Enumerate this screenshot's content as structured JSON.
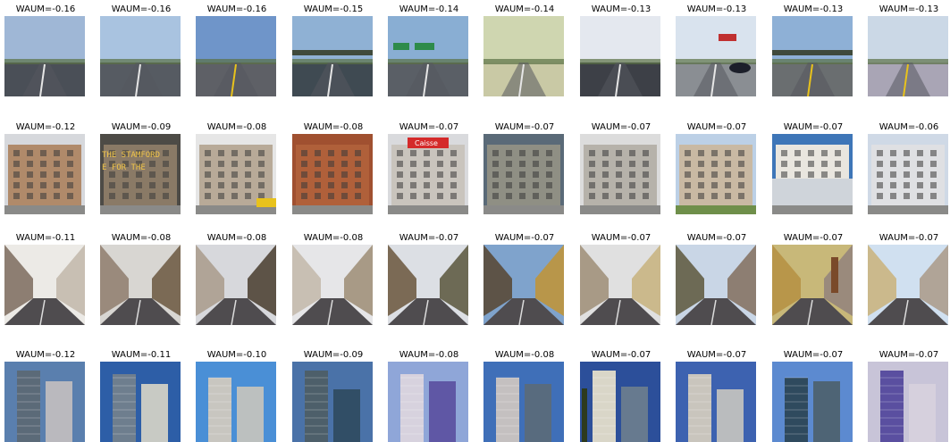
{
  "rows": [
    {
      "scene": "highway",
      "labels": [
        "WAUM=-0.16",
        "WAUM=-0.16",
        "WAUM=-0.16",
        "WAUM=-0.15",
        "WAUM=-0.14",
        "WAUM=-0.14",
        "WAUM=-0.13",
        "WAUM=-0.13",
        "WAUM=-0.13",
        "WAUM=-0.13"
      ]
    },
    {
      "scene": "building",
      "labels": [
        "WAUM=-0.12",
        "WAUM=-0.09",
        "WAUM=-0.08",
        "WAUM=-0.08",
        "WAUM=-0.07",
        "WAUM=-0.07",
        "WAUM=-0.07",
        "WAUM=-0.07",
        "WAUM=-0.07",
        "WAUM=-0.06"
      ]
    },
    {
      "scene": "street",
      "labels": [
        "WAUM=-0.11",
        "WAUM=-0.08",
        "WAUM=-0.08",
        "WAUM=-0.08",
        "WAUM=-0.07",
        "WAUM=-0.07",
        "WAUM=-0.07",
        "WAUM=-0.07",
        "WAUM=-0.07",
        "WAUM=-0.07"
      ]
    },
    {
      "scene": "tallbuilding",
      "labels": [
        "WAUM=-0.12",
        "WAUM=-0.11",
        "WAUM=-0.10",
        "WAUM=-0.09",
        "WAUM=-0.08",
        "WAUM=-0.08",
        "WAUM=-0.07",
        "WAUM=-0.07",
        "WAUM=-0.07",
        "WAUM=-0.07"
      ]
    }
  ],
  "overlay_text": {
    "stamford_line1": "THE STAMFORD",
    "stamford_line2": "E FOR THE",
    "caisse_sign": "Caisse"
  }
}
